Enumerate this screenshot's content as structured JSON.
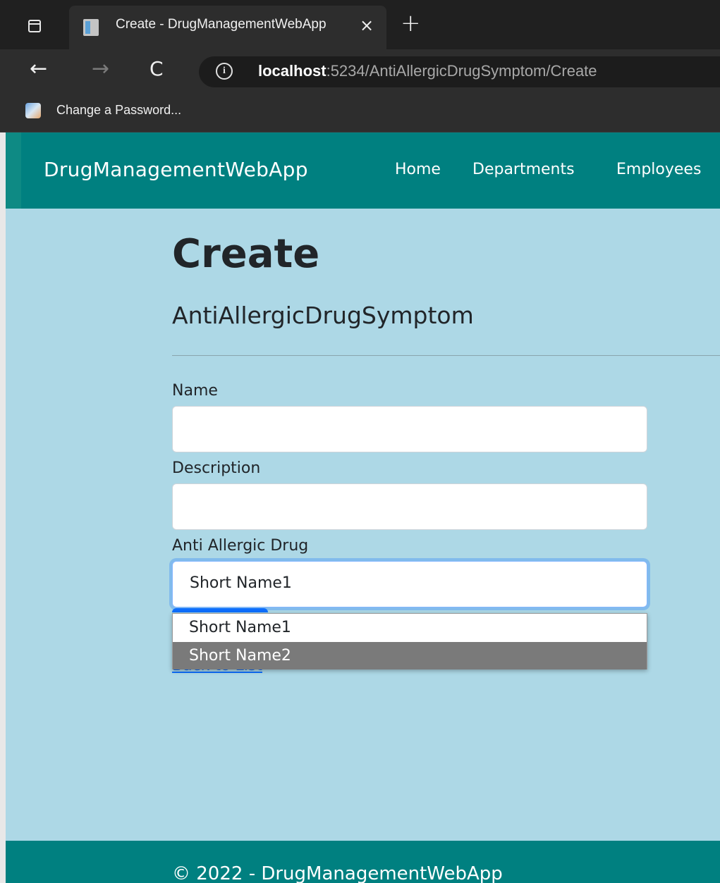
{
  "browser": {
    "tab_title": "Create - DrugManagementWebApp",
    "close_glyph": "×",
    "new_tab_glyph": "+",
    "back_glyph": "←",
    "forward_glyph": "→",
    "reload_glyph": "C",
    "info_glyph": "i",
    "url_host": "localhost",
    "url_rest": ":5234/AntiAllergicDrugSymptom/Create",
    "bookmark_label": "Change a Password...",
    "icons": [
      "tab-actions-icon",
      "page-favicon-icon",
      "close-icon",
      "plus-icon",
      "back-arrow-icon",
      "forward-arrow-icon",
      "reload-icon",
      "info-icon",
      "bookmark-favicon-icon"
    ]
  },
  "header": {
    "brand": "DrugManagementWebApp",
    "menu": [
      {
        "label": "Home"
      },
      {
        "label": "Departments"
      },
      {
        "label": "Employees"
      }
    ],
    "color": "#008080"
  },
  "main": {
    "title": "Create",
    "subtitle": "AntiAllergicDrugSymptom",
    "fields": {
      "name_label": "Name",
      "name_value": "",
      "description_label": "Description",
      "description_value": "",
      "drug_label": "Anti Allergic Drug",
      "drug_selected": "Short Name1",
      "drug_options": [
        "Short Name1",
        "Short Name2"
      ]
    },
    "back_link": "Back to List",
    "page_background": "#add8e6"
  },
  "footer": {
    "text": "© 2022 - DrugManagementWebApp"
  }
}
